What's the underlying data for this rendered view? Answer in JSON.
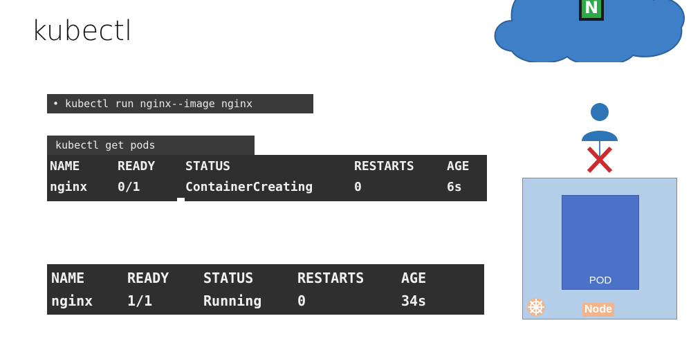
{
  "page": {
    "title": "kubectl"
  },
  "run_command": {
    "text": "• kubectl run nginx--image nginx"
  },
  "terminal_top": {
    "title": "kubectl get pods",
    "headers": [
      "NAME",
      "READY",
      "STATUS",
      "RESTARTS",
      "AGE"
    ],
    "row": [
      "nginx",
      "0/1",
      "ContainerCreating",
      "0",
      "6s"
    ]
  },
  "terminal_bottom": {
    "headers": [
      "NAME",
      "READY",
      "STATUS",
      "RESTARTS",
      "AGE"
    ],
    "row": [
      "nginx",
      "1/1",
      "Running",
      "0",
      "34s"
    ]
  },
  "diagram": {
    "pod_label": "POD",
    "node_label": "Node",
    "cloud_logo_letter": "N",
    "icons": [
      "cloud-icon",
      "nginx-logo-icon",
      "user-icon",
      "blocked-x-icon",
      "kubernetes-wheel-icon"
    ],
    "colors": {
      "cloud": "#3f7fc7",
      "pod": "#4c72c7",
      "node": "#b4cde9",
      "blocked": "#cc2b2b",
      "user": "#2e75b6"
    }
  }
}
